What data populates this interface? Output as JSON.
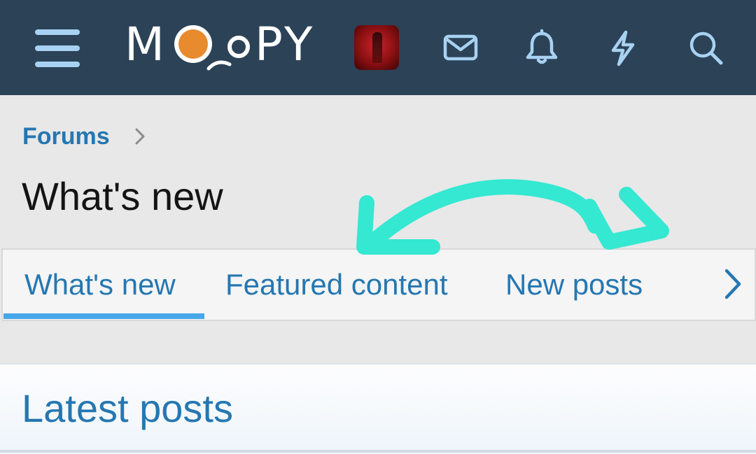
{
  "header": {
    "logo_text": "MOOPY",
    "logo_letters": [
      "M",
      "O",
      "O",
      "P",
      "Y"
    ],
    "colors": {
      "background": "#2c4257",
      "icons": "#a8d2f2",
      "logo_accent": "#e88a2e"
    },
    "icons": [
      "menu-icon",
      "avatar",
      "mail-icon",
      "bell-icon",
      "bolt-icon",
      "search-icon"
    ]
  },
  "breadcrumb": {
    "label": "Forums",
    "icon": "chevron-right-icon"
  },
  "page": {
    "title": "What's new"
  },
  "tabs": {
    "items": [
      {
        "label": "What's new",
        "active": true
      },
      {
        "label": "Featured content",
        "active": false
      },
      {
        "label": "New posts",
        "active": false
      }
    ],
    "next_icon": "chevron-right-icon",
    "colors": {
      "text": "#2577b1",
      "active_underline": "#47a7eb"
    }
  },
  "section": {
    "title": "Latest posts"
  },
  "annotation": {
    "icon": "hand-drawn-double-arrow",
    "color": "#34e8d2"
  }
}
